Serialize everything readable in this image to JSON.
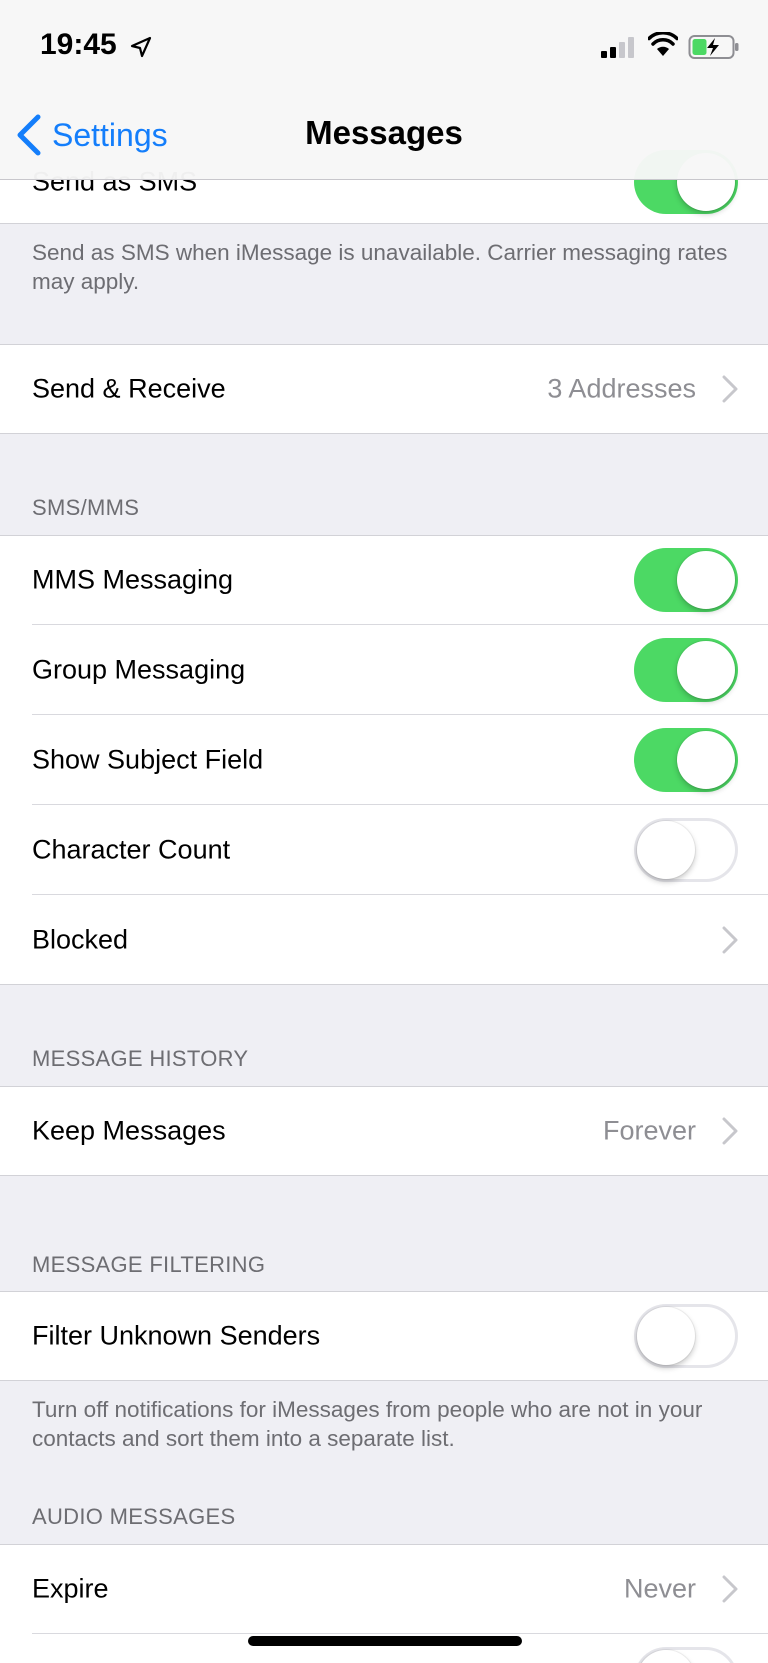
{
  "status_bar": {
    "time": "19:45"
  },
  "nav": {
    "back_label": "Settings",
    "title": "Messages"
  },
  "rows": {
    "send_as_sms": {
      "label": "Send as SMS",
      "on": true
    },
    "send_receive": {
      "label": "Send & Receive",
      "detail": "3 Addresses"
    },
    "mms_messaging": {
      "label": "MMS Messaging",
      "on": true
    },
    "group_messaging": {
      "label": "Group Messaging",
      "on": true
    },
    "show_subject_field": {
      "label": "Show Subject Field",
      "on": true
    },
    "character_count": {
      "label": "Character Count",
      "on": false
    },
    "blocked": {
      "label": "Blocked"
    },
    "keep_messages": {
      "label": "Keep Messages",
      "detail": "Forever"
    },
    "filter_unknown": {
      "label": "Filter Unknown Senders",
      "on": false
    },
    "expire": {
      "label": "Expire",
      "detail": "Never"
    }
  },
  "sections": {
    "sms_footer": "Send as SMS when iMessage is unavailable. Carrier messaging rates may apply.",
    "sms_mms": "SMS/MMS",
    "message_history": "MESSAGE HISTORY",
    "message_filtering": "MESSAGE FILTERING",
    "filter_footer": "Turn off notifications for iMessages from people who are not in your contacts and sort them into a separate list.",
    "audio_messages": "AUDIO MESSAGES"
  },
  "colors": {
    "accent": "#147efb",
    "toggle_on": "#4cd964",
    "background": "#efeff4"
  }
}
